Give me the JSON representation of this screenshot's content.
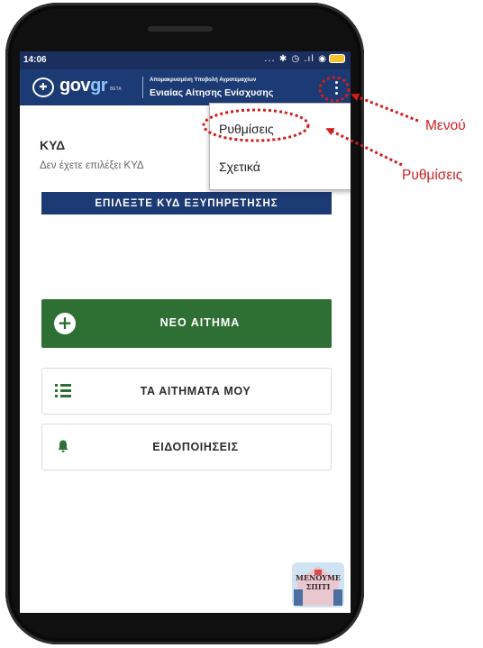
{
  "status_bar": {
    "time": "14:06",
    "icons": "... ✱ ◷ .ıl ◉"
  },
  "app_bar": {
    "logo_main": "gov",
    "logo_accent": "gr",
    "logo_beta": "BETA",
    "subtitle_small": "Απομακρυσμένη Υποβολή Αγροτεμαχίων",
    "subtitle": "Ενιαίας Αίτησης Ενίσχυσης"
  },
  "kyd": {
    "title": "ΚΥΔ",
    "subtitle": "Δεν έχετε επιλέξει ΚΥΔ",
    "select_button": "ΕΠΙΛΕΞΤΕ ΚΥΔ ΕΞΥΠΗΡΕΤΗΣΗΣ"
  },
  "actions": {
    "new_request": "ΝΕΟ ΑΙΤΗΜΑ",
    "my_requests": "ΤΑ ΑΙΤΗΜΑΤΑ ΜΟΥ",
    "notifications": "ΕΙΔΟΠΟΙΗΣΕΙΣ"
  },
  "menu": {
    "items": [
      "Ρυθμίσεις",
      "Σχετικά"
    ]
  },
  "watermark": {
    "line1": "ΜΕΝΟΥΜΕ",
    "line2": "ΣΠΙΤΙ"
  },
  "annotations": {
    "menu_label": "Μενού",
    "settings_label": "Ρυθμίσεις"
  },
  "colors": {
    "app_bar": "#1c3a73",
    "primary_green": "#2e7033",
    "annotation_red": "#d31d1d"
  }
}
